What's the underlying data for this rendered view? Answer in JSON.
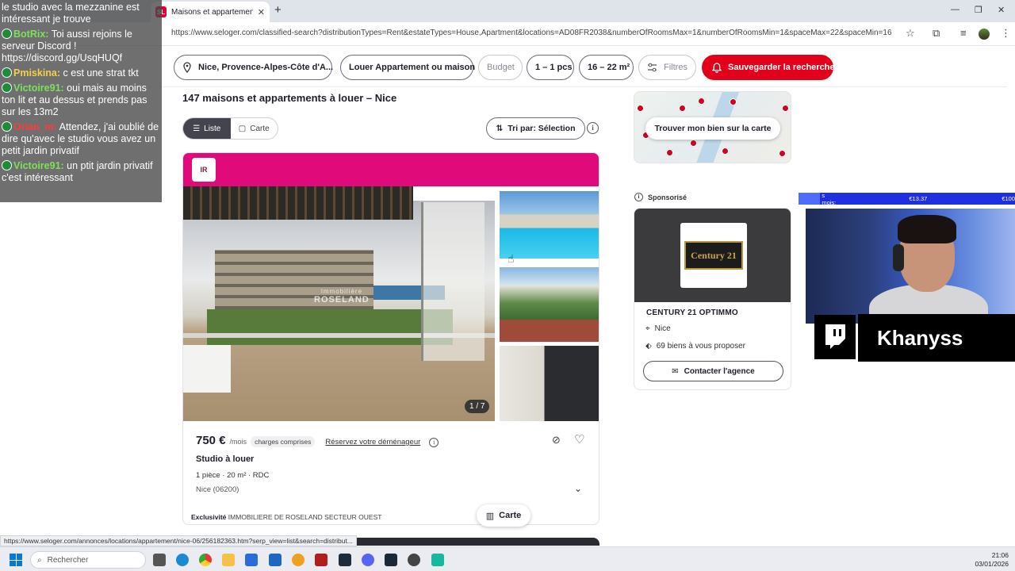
{
  "browser": {
    "tab_title": "Maisons et appartements à lou",
    "tab_favicon": "SL",
    "new_tab": "+",
    "url": "https://www.seloger.com/classified-search?distributionTypes=Rent&estateTypes=House,Apartment&locations=AD08FR2038&numberOfRoomsMax=1&numberOfRoomsMin=1&spaceMax=22&spaceMin=16",
    "status_url": "https://www.seloger.com/annonces/locations/appartement/nice-06/256182363.htm?serp_view=list&search=distribut..."
  },
  "filters": {
    "location": "Nice, Provence-Alpes-Côte d'A...",
    "transaction": "Louer Appartement ou maison",
    "budget": "Budget",
    "rooms": "1 – 1 pcs",
    "surface": "16 – 22 m²",
    "more": "Filtres",
    "save": "Sauvegarder la recherche"
  },
  "chat": [
    {
      "user": "",
      "text": "le studio avec la mezzanine est intéressant je trouve",
      "color": "#ffffff"
    },
    {
      "user": "BotRix:",
      "text": " Toi aussi rejoins le serveur Discord ! https://discord.gg/UsqHUQf",
      "color": "#7ee05a"
    },
    {
      "user": "Pmiskina:",
      "text": " c est une strat tkt",
      "color": "#f2d14a"
    },
    {
      "user": "Victoire91:",
      "text": " oui mais au moins ton lit et au dessus et prends pas sur les 13m2",
      "color": "#7ee05a"
    },
    {
      "user": "Orian_m:",
      "text": " Attendez, j'ai oublié de dire qu'avec le studio vous avez un petit jardin privatif",
      "color": "#ff3b3b"
    },
    {
      "user": "Victoire91:",
      "text": " un ptit jardin privatif c'est intéressant",
      "color": "#7ee05a"
    }
  ],
  "results": {
    "title": "147 maisons et appartements à louer – Nice",
    "view_list": "Liste",
    "view_map": "Carte",
    "sort": "Tri par: Sélection"
  },
  "listing": {
    "agency_logo": "IR",
    "watermark_brand": "ROSELAND",
    "watermark_sub": "Immobilière",
    "photo_counter": "1 / 7",
    "price": "750 €",
    "per_month": "/mois",
    "charges": "charges comprises",
    "mover_link": "Réservez votre déménageur",
    "type": "Studio à louer",
    "details": "1 pièce  ·  20 m²  ·  RDC",
    "location": "Nice (06200)",
    "exclusivity_label": "Exclusivité",
    "agency_name": "IMMOBILIERE DE ROSELAND SECTEUR OUEST"
  },
  "floating_map_button": "Carte",
  "map_widget": {
    "button": "Trouver mon bien sur la carte"
  },
  "sponsored": {
    "label": "Sponsorisé",
    "logo_text": "Century 21",
    "agency": "CENTURY 21 OPTIMMO",
    "city": "Nice",
    "offers": "69 biens à vous proposer",
    "contact": "Contacter l'agence"
  },
  "stream": {
    "donation_label": "s mois:",
    "donation_current": "€13.37",
    "donation_goal": "€100",
    "streamer": "Khanyss"
  },
  "taskbar": {
    "search_placeholder": "Rechercher",
    "time": "21:06",
    "date": "03/01/2026"
  },
  "colors": {
    "brand_red": "#e3001b",
    "card_header_pink": "#e10a7a",
    "donation_blue": "#2030e0"
  }
}
